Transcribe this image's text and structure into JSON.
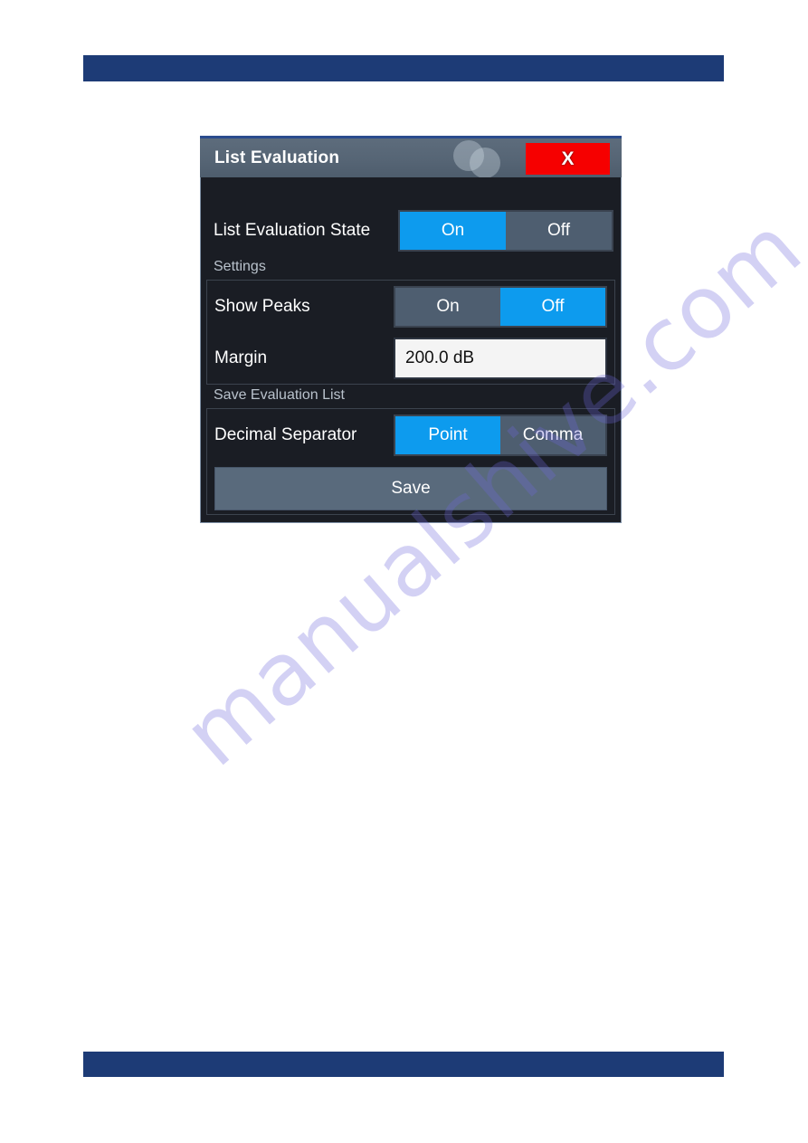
{
  "page": {
    "watermark_text": "manualshive.com",
    "header_bar_color": "#1d3b76",
    "footer_bar_color": "#1d3b76"
  },
  "dialog": {
    "title": "List Evaluation",
    "close_label": "X",
    "decoration_icon": "overlapping-circles-icon",
    "accent_color": "#0d9bee",
    "close_color": "#f60000",
    "rows": {
      "list_evaluation_state": {
        "label": "List Evaluation State",
        "on_label": "On",
        "off_label": "Off",
        "selected": "On"
      },
      "show_peaks": {
        "label": "Show Peaks",
        "on_label": "On",
        "off_label": "Off",
        "selected": "Off"
      },
      "margin": {
        "label": "Margin",
        "value": "200.0 dB"
      },
      "decimal_separator": {
        "label": "Decimal Separator",
        "point_label": "Point",
        "comma_label": "Comma",
        "selected": "Point"
      }
    },
    "sections": {
      "settings": "Settings",
      "save_evaluation_list": "Save Evaluation List"
    },
    "save_button_label": "Save"
  }
}
